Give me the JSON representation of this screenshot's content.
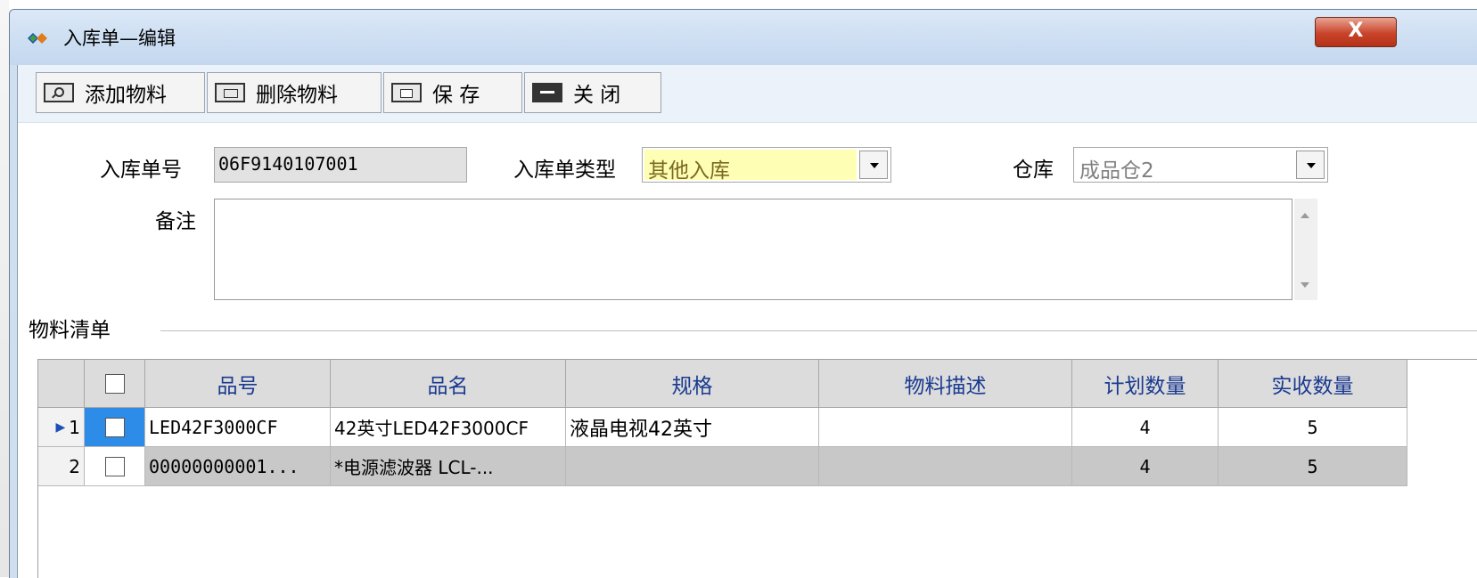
{
  "window": {
    "title": "入库单—编辑",
    "close_label": "X"
  },
  "toolbar": {
    "add": "添加物料",
    "delete": "删除物料",
    "save": "保 存",
    "close": "关 闭"
  },
  "form": {
    "order_no_label": "入库单号",
    "order_no_value": "06F9140107001",
    "type_label": "入库单类型",
    "type_value": "其他入库",
    "warehouse_label": "仓库",
    "warehouse_value": "成品仓2",
    "remark_label": "备注",
    "remark_value": ""
  },
  "materials": {
    "group_title": "物料清单",
    "columns": [
      "品号",
      "品名",
      "规格",
      "物料描述",
      "计划数量",
      "实收数量"
    ],
    "rows": [
      {
        "index": "1",
        "code": "LED42F3000CF",
        "name": "42英寸LED42F3000CF",
        "spec": "液晶电视42英寸",
        "desc": "",
        "plan": "4",
        "actual": "5"
      },
      {
        "index": "2",
        "code": "00000000001...",
        "name": "*电源滤波器 LCL-...",
        "spec": "",
        "desc": "",
        "plan": "4",
        "actual": "5"
      }
    ]
  },
  "colors": {
    "highlight_field": "#fefeb4",
    "header_text": "#1a3a90",
    "selected_row": "#2d8ce8"
  }
}
